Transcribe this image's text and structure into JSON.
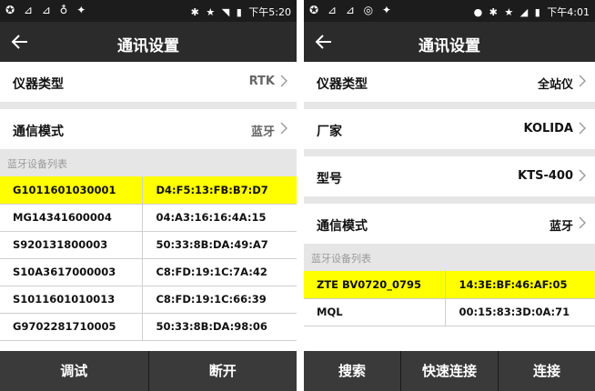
{
  "left": {
    "status": {
      "time": "下午5:20"
    },
    "title": "通讯设置",
    "rows": [
      {
        "label": "仪器类型",
        "value": "RTK"
      },
      {
        "label": "通信模式",
        "value": "蓝牙"
      }
    ],
    "section": "蓝牙设备列表",
    "devices": [
      {
        "name": "G1011601030001",
        "mac": "D4:F5:13:FB:B7:D7",
        "highlighted": true
      },
      {
        "name": "MG14341600004",
        "mac": "04:A3:16:16:4A:15"
      },
      {
        "name": "S920131800003",
        "mac": "50:33:8B:DA:49:A7"
      },
      {
        "name": "S10A3617000003",
        "mac": "C8:FD:19:1C:7A:42"
      },
      {
        "name": "S1011601010013",
        "mac": "C8:FD:19:1C:66:39"
      },
      {
        "name": "G9702281710005",
        "mac": "50:33:8B:DA:98:06"
      }
    ],
    "buttons": {
      "debug": "调试",
      "disconnect": "断开"
    }
  },
  "right": {
    "status": {
      "time": "下午4:01"
    },
    "title": "通讯设置",
    "rows": [
      {
        "label": "仪器类型",
        "value": "全站仪"
      },
      {
        "label": "厂家",
        "value": "KOLIDA"
      },
      {
        "label": "型号",
        "value": "KTS-400"
      },
      {
        "label": "通信模式",
        "value": "蓝牙"
      }
    ],
    "section": "蓝牙设备列表",
    "devices": [
      {
        "name": "ZTE BV0720_0795",
        "mac": "14:3E:BF:46:AF:05",
        "highlighted": true
      },
      {
        "name": "MQL",
        "mac": "00:15:83:3D:0A:71"
      }
    ],
    "buttons": {
      "search": "搜索",
      "quick_connect": "快速连接",
      "connect": "连接"
    }
  },
  "colors": {
    "highlight": "#ffff00",
    "appbar": "#2b2b2b",
    "bottombar": "#3a3a3a"
  }
}
